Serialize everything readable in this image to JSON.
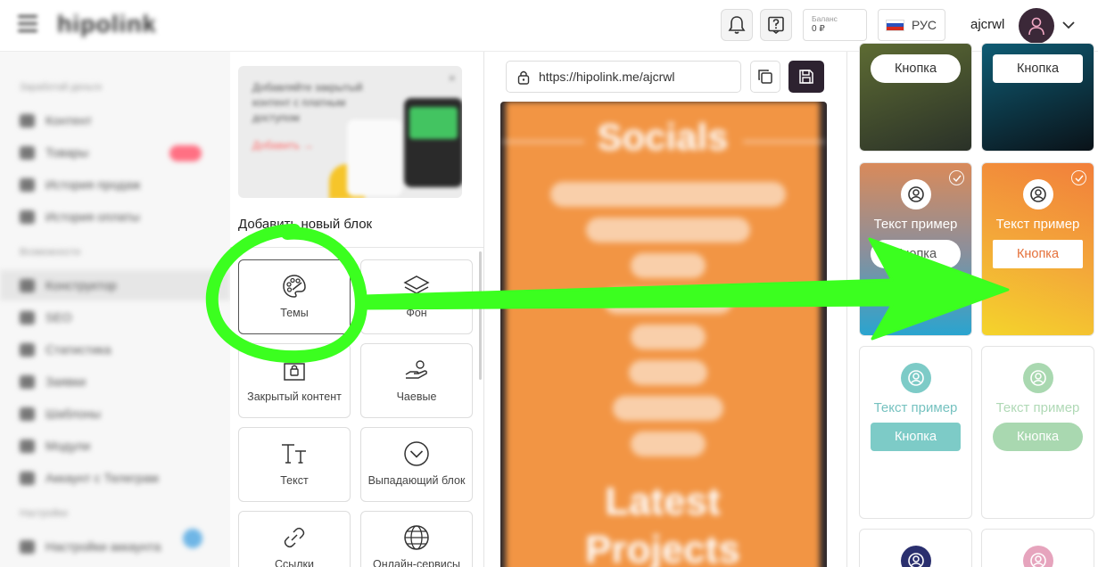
{
  "header": {
    "logo": "hipolink",
    "balance_label": "Баланс",
    "balance_value": "0 ₽",
    "language": "РУС",
    "username": "ajcrwl",
    "icons": [
      "menu-icon",
      "bell-icon",
      "help-icon",
      "flag-ru-icon",
      "user-icon",
      "chevron-down-icon"
    ]
  },
  "sidebar": {
    "sections": [
      "Заработай деньги",
      "Возможности",
      "Настройки"
    ],
    "items": [
      {
        "label": "Контент"
      },
      {
        "label": "Товары"
      },
      {
        "label": "История продаж"
      },
      {
        "label": "История оплаты"
      },
      {
        "label": "Конструктор"
      },
      {
        "label": "SEO"
      },
      {
        "label": "Статистика"
      },
      {
        "label": "Заявки"
      },
      {
        "label": "Шаблоны"
      },
      {
        "label": "Модули"
      },
      {
        "label": "Аккаунт с Телеграм"
      },
      {
        "label": "Настройки аккаунта"
      }
    ]
  },
  "blocks_panel": {
    "promo": {
      "text": "Добавляйте закрытый контент с платным доступом",
      "action": "Добавить →",
      "close": "×"
    },
    "title": "Добавить новый блок",
    "blocks": [
      {
        "label": "Темы",
        "icon": "palette-icon"
      },
      {
        "label": "Фон",
        "icon": "layers-icon"
      },
      {
        "label": "Закрытый контент",
        "icon": "lock-icon"
      },
      {
        "label": "Чаевые",
        "icon": "tip-hand-icon"
      },
      {
        "label": "Текст",
        "icon": "text-icon"
      },
      {
        "label": "Выпадающий блок",
        "icon": "chevron-circle-icon"
      },
      {
        "label": "Ссылки",
        "icon": "link-icon"
      },
      {
        "label": "Онлайн-сервисы",
        "icon": "globe-icon"
      }
    ]
  },
  "preview": {
    "url": "https://hipolink.me/ajcrwl",
    "page_heading": "Socials",
    "page_heading_2": "Latest",
    "page_heading_3": "Projects",
    "links": [
      "ArtStation (my works)",
      "Society Site Discord",
      "Twitter",
      "Instagram",
      "Tumblr",
      "Behance",
      "Artist Site",
      "DeviantArt"
    ]
  },
  "themes": {
    "sample_text": "Текст пример",
    "button_label": "Кнопка",
    "cards": [
      {
        "id": "olive",
        "colors": [
          "#5d6b33",
          "#2a3128"
        ],
        "selected": false
      },
      {
        "id": "teal-dark",
        "colors": [
          "#0f5c74",
          "#0a1218"
        ],
        "selected": false
      },
      {
        "id": "sunset",
        "colors": [
          "#d98a5a",
          "#2aa4cf"
        ],
        "selected": false
      },
      {
        "id": "orange-yellow",
        "colors": [
          "#f27f3b",
          "#f4d42b"
        ],
        "selected": true
      },
      {
        "id": "mint",
        "colors": [
          "#7dcbc7"
        ],
        "selected": false
      },
      {
        "id": "light-green",
        "colors": [
          "#a9d8b0"
        ],
        "selected": false
      },
      {
        "id": "navy",
        "colors": [
          "#2a2f6e"
        ],
        "selected": false
      },
      {
        "id": "pink",
        "colors": [
          "#e6a4bd"
        ],
        "selected": false
      }
    ]
  },
  "annotation": {
    "color": "#3bff1f"
  }
}
